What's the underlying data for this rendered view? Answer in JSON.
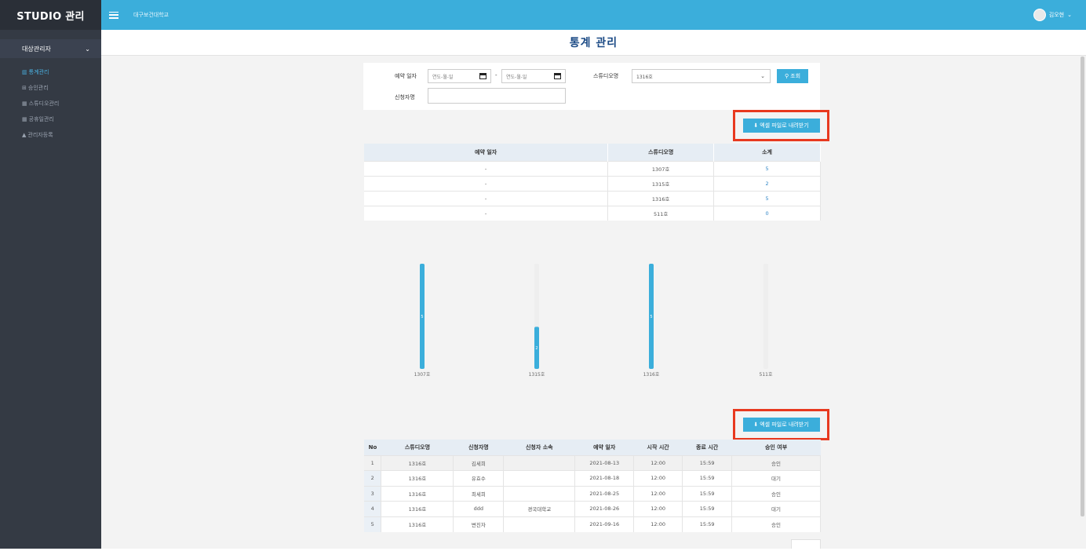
{
  "app": {
    "brand": "STUDIO 관리",
    "organization": "대구보건대학교",
    "user_name": "김오현"
  },
  "sidebar": {
    "group_label": "대상관리자",
    "items": [
      {
        "label": "통계관리",
        "icon": "chart-icon",
        "glyph": "▥",
        "active": true
      },
      {
        "label": "승인관리",
        "icon": "approve-icon",
        "glyph": "⊞",
        "active": false
      },
      {
        "label": "스튜디오관리",
        "icon": "calendar-icon",
        "glyph": "▦",
        "active": false
      },
      {
        "label": "공휴일관리",
        "icon": "calendar-icon",
        "glyph": "▦",
        "active": false
      },
      {
        "label": "관리자등록",
        "icon": "person-icon",
        "glyph": "▲",
        "active": false
      }
    ]
  },
  "page": {
    "title": "통계 관리"
  },
  "filter": {
    "date_label": "예약 일자",
    "date_from_placeholder": "연도-월-일",
    "date_to_placeholder": "연도-월-일",
    "date_separator": "-",
    "studio_label": "스튜디오명",
    "studio_selected": "1316호",
    "search_button": "조회",
    "applicant_label": "신청자명",
    "applicant_value": ""
  },
  "excel_button_label": "엑셀 파일로 내려받기",
  "summary_table": {
    "headers": [
      "예약 일자",
      "스튜디오명",
      "소계"
    ],
    "rows": [
      [
        "-",
        "1307호",
        "5"
      ],
      [
        "-",
        "1315호",
        "2"
      ],
      [
        "-",
        "1316호",
        "5"
      ],
      [
        "-",
        "511호",
        "0"
      ]
    ]
  },
  "chart_data": {
    "type": "bar",
    "orientation": "vertical",
    "categories": [
      "1307호",
      "1315호",
      "1316호",
      "511호"
    ],
    "values": [
      5,
      2,
      5,
      0
    ],
    "ylim": [
      0,
      5
    ],
    "bar_color": "#3baedb",
    "track_color": "#eeeeee",
    "title": "",
    "xlabel": "",
    "ylabel": ""
  },
  "detail_table": {
    "headers": [
      "No",
      "스튜디오명",
      "신청자명",
      "신청자 소속",
      "예약 일자",
      "시작 시간",
      "종료 시간",
      "승인 여부"
    ],
    "rows": [
      [
        "1",
        "1316호",
        "김세희",
        "",
        "2021-08-13",
        "12:00",
        "15:59",
        "승인"
      ],
      [
        "2",
        "1316호",
        "유효수",
        "",
        "2021-08-18",
        "12:00",
        "15:59",
        "대기"
      ],
      [
        "3",
        "1316호",
        "최세희",
        "",
        "2021-08-25",
        "12:00",
        "15:59",
        "승인"
      ],
      [
        "4",
        "1316호",
        "ddd",
        "경국대학교",
        "2021-08-26",
        "12:00",
        "15:59",
        "대기"
      ],
      [
        "5",
        "1316호",
        "변진자",
        "",
        "2021-09-16",
        "12:00",
        "15:59",
        "승인"
      ]
    ]
  },
  "colors": {
    "accent": "#3baedb",
    "sidebar": "#343a44",
    "highlight_border": "#e8391f",
    "title": "#1b4a85"
  }
}
